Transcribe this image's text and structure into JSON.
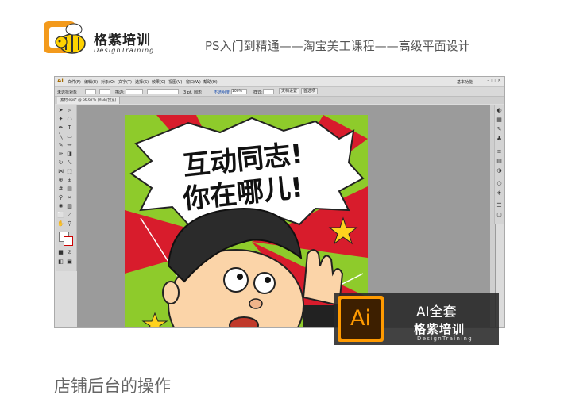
{
  "header": {
    "brand_cn": "格紫培训",
    "brand_en": "DesignTraining",
    "course_title": "PS入门到精通——淘宝美工课程——高级平面设计"
  },
  "app": {
    "logo": "Ai",
    "menu": [
      "文件(F)",
      "编辑(E)",
      "对象(O)",
      "文字(T)",
      "选择(S)",
      "效果(C)",
      "视图(V)",
      "窗口(W)",
      "帮助(H)"
    ],
    "workspace": "基本功能",
    "window_controls": "–□×",
    "control_bar": {
      "selection_label": "未选择对象",
      "stroke_label": "描边:",
      "stroke_value": "3 pt. 圆形",
      "opacity_label": "不透明度:",
      "opacity_value": "100%",
      "style_label": "样式:",
      "doc_setup": "文档设置",
      "preferences": "首选项"
    },
    "doc_tab": "素材.eps* @ 66.67% (RGB/预览)",
    "artwork_text_line1": "互动同志!",
    "artwork_text_line2": "你在哪儿!"
  },
  "badge": {
    "logo": "Ai",
    "title": "AI全套",
    "brand_cn": "格紫培训",
    "brand_en": "DesignTraining"
  },
  "caption": "店铺后台的操作",
  "colors": {
    "accent_orange": "#ff9a00",
    "artwork_green": "#8ecb2b",
    "artwork_red": "#d81c2c"
  }
}
